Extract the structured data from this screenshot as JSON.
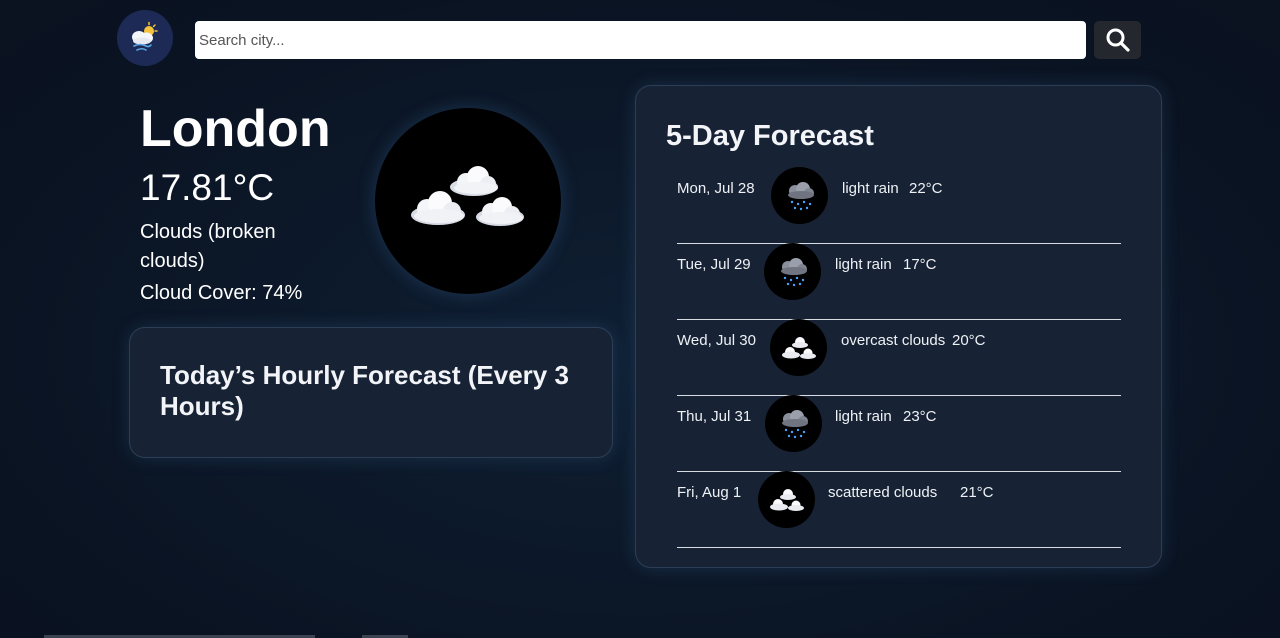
{
  "search": {
    "placeholder": "Search city...",
    "value": ""
  },
  "current": {
    "city": "London",
    "temperature": "17.81°C",
    "description": "Clouds (broken clouds)",
    "cloud_cover": "Cloud Cover: 74%",
    "icon": "broken-clouds-icon"
  },
  "hourly": {
    "title": "Today’s Hourly Forecast (Every 3 Hours)"
  },
  "forecast": {
    "title": "5-Day Forecast",
    "days": [
      {
        "date": "Mon, Jul 28",
        "icon": "light-rain-icon",
        "description": "light rain",
        "temp": "22°C"
      },
      {
        "date": "Tue, Jul 29",
        "icon": "light-rain-icon",
        "description": "light rain",
        "temp": "17°C"
      },
      {
        "date": "Wed, Jul 30",
        "icon": "clouds-icon",
        "description": "overcast clouds",
        "temp": "20°C"
      },
      {
        "date": "Thu, Jul 31",
        "icon": "light-rain-icon",
        "description": "light rain",
        "temp": "23°C"
      },
      {
        "date": "Fri, Aug 1",
        "icon": "clouds-icon",
        "description": "scattered clouds",
        "temp": "21°C"
      }
    ]
  },
  "colors": {
    "background": "#0c1829",
    "card": "#172335",
    "logo_circle": "#1c2a55",
    "search_button": "#24282e"
  }
}
